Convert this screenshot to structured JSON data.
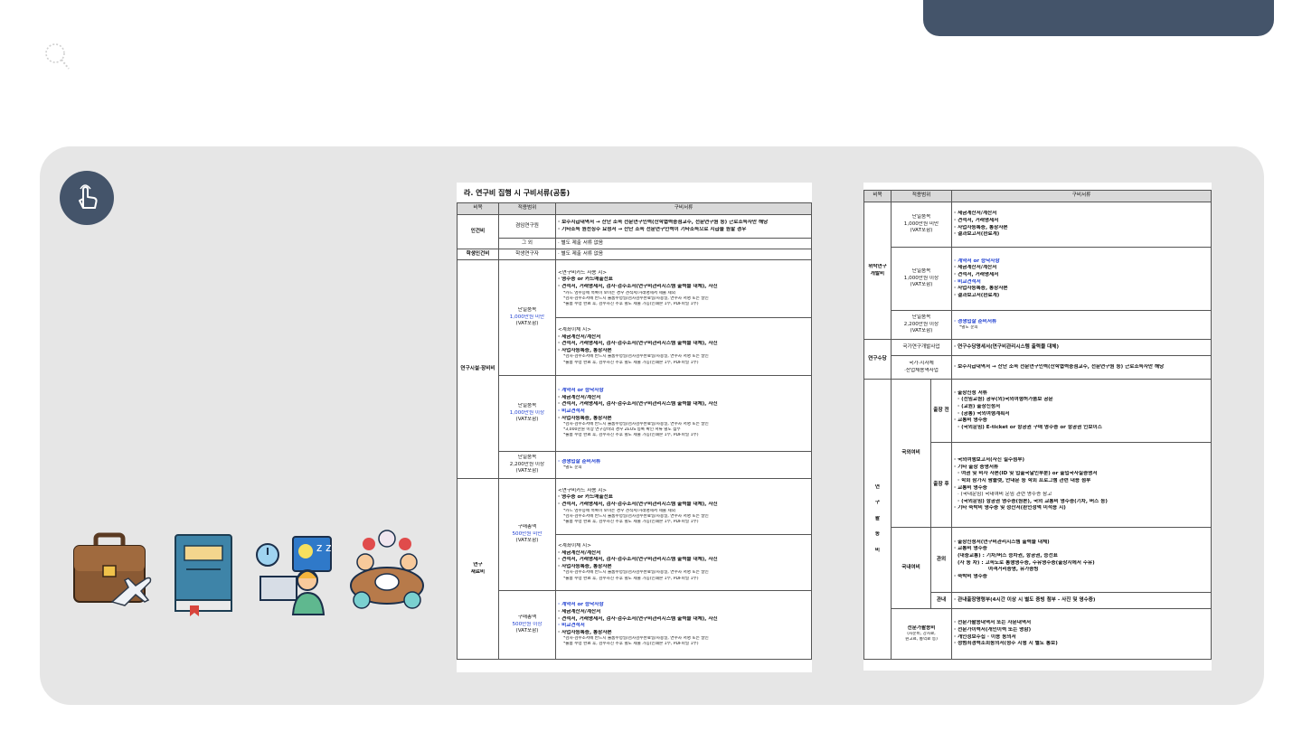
{
  "header": {
    "accent": "#44546a"
  },
  "icons": {
    "touch": "touch-hand-icon",
    "set": [
      "briefcase-travel-icon",
      "book-icon",
      "meeting-work-icon",
      "discussion-group-icon"
    ]
  },
  "left": {
    "title": "라. 연구비 집행 시 구비서류(공통)",
    "h1": "비목",
    "h2": "적용범위",
    "h3": "구비서류",
    "r1": {
      "cat": "인건비",
      "scope": "겸임연구원",
      "d1": "· 보수지급내역서 → 산단 소속 전문연구인력(산학협력중점교수, 전문연구원 등) 근로소득자만 해당",
      "d2": "· 기타소득 원천징수 요청서 → 산단 소속 전문연구인력이 기타소득으로 지급을 원할 경우"
    },
    "r2": {
      "scope": "그 외",
      "d": "· 별도 제출 서류 없음"
    },
    "r3": {
      "cat": "학생인건비",
      "scope": "학생연구자",
      "d": "· 별도 제출 서류 없음"
    },
    "r4": {
      "cat": "연구시설·장비비",
      "s1": {
        "scope1": "단일품목",
        "scope2": "1,000만원 미만",
        "scope3": "(VAT포함)",
        "a0": "<연구비카드 사용 시>",
        "a1": "· 영수증 or 카드매출전표",
        "a2": "· 견적서, 거래명세서, 검사·검수조서(연구비관리시스템 출력물 대체), 사진",
        "a3": "*카드 영수증에 목록이 보이는 경우 견적서/거래명세서 제출 제외",
        "a4": "*검사·검수조서에 반드시 물품수령일/검사검수완료일/사용일, 연수자 서명 또는 날인",
        "a5": "*물품 수령 완료 후, 검수사진 추후 별도 제출 가능(인쇄본 1부, PDF파일 1부)",
        "b0": "<계좌이체 시>",
        "b1": "· 세금계산서/계산서",
        "b2": "· 견적서, 거래명세서, 검사·검수조서(연구비관리시스템 출력물 대체), 사진",
        "b3": "· 사업자등록증, 통장사본",
        "b4": "*검사·검수조서에 반드시 물품수령일/검사검수완료일/사용일, 연수자 서명 또는 날인",
        "b5": "*물품 수령 완료 후, 검수사진 추후 별도 제출 가능(인쇄본 1부, PDF파일 1부)"
      },
      "s2": {
        "scope1": "단일품목",
        "scope2": "1,000만원 이상",
        "scope3": "(VAT포함)",
        "c1": "· 계약서 or 승낙사항",
        "c2": "· 세금계산서/계산서",
        "c3": "· 견적서, 거래명세서, 검사·검수조서(연구비관리시스템 출력물 대체), 사진",
        "c4": "· 비교견적서",
        "c5": "· 사업자등록증, 통장사본",
        "c6": "*검사·검수조서에 반드시 물품수령일/검사검수완료일/사용일, 연수자 서명 또는 날인",
        "c7": "*3,000만원 이상 연구장비의 경우 ZEUS 등록 확인 서류 별도 첨부",
        "c8": "*물품 수령 완료 후, 검수사진 추후 별도 제출 가능(인쇄본 1부, PDF파일 1부)"
      },
      "s3": {
        "scope1": "단일품목",
        "scope2": "2,200만원 이상",
        "scope3": "(VAT포함)",
        "d1": "· 경쟁입찰 준비서류",
        "d2": "*별도 문의"
      }
    },
    "r5": {
      "cat1": "연구",
      "cat2": "재료비",
      "s1": {
        "scope1": "구매총액",
        "scope2": "500만원 미만",
        "scope3": "(VAT포함)",
        "a0": "<연구비카드 사용 시>",
        "a1": "· 영수증 or 카드매출전표",
        "a2": "· 견적서, 거래명세서, 검사·검수조서(연구비관리시스템 출력물 대체), 사진",
        "a3": "*카드 영수증에 목록이 보이는 경우 견적서/거래명세서 제출 제외",
        "a4": "*검사·검수조서에 반드시 물품수령일/검사검수완료일/사용일, 연수자 서명 또는 날인",
        "a5": "*물품 수령 완료 후, 검수사진 추후 별도 제출 가능(인쇄본 1부, PDF파일 1부)",
        "b0": "<계좌이체 시>",
        "b1": "· 세금계산서/계산서",
        "b2": "· 견적서, 거래명세서, 검사·검수조서(연구비관리시스템 출력물 대체), 사진",
        "b3": "· 사업자등록증, 통장사본",
        "b4": "*검사·검수조서에 반드시 물품수령일/검사검수완료일/사용일, 연수자 서명 또는 날인",
        "b5": "*물품 수령 완료 후, 검수사진 추후 별도 제출 가능(인쇄본 1부, PDF파일 1부)"
      },
      "s2": {
        "scope1": "구매총액",
        "scope2": "500만원 이상",
        "scope3": "(VAT포함)",
        "c1": "· 계약서 or 승낙사항",
        "c2": "· 세금계산서/계산서",
        "c3": "· 견적서, 거래명세서, 검사·검수조서(연구비관리시스템 출력물 대체), 사진",
        "c4": "· 비교견적서",
        "c5": "· 사업자등록증, 통장사본",
        "c6": "*검사·검수조서에 반드시 물품수령일/검사검수완료일/사용일, 연수자 서명 또는 날인",
        "c7": "*물품 수령 완료 후, 검수사진 추후 별도 제출 가능(인쇄본 1부, PDF파일 1부)"
      }
    }
  },
  "right": {
    "h1": "비목",
    "h2": "적용범위",
    "h3": "구비서류",
    "w": {
      "cat1": "위탁연구",
      "cat2": "개발비",
      "s1": {
        "scope1": "단일품목",
        "scope2": "1,000만원 미만",
        "scope3": "(VAT포함)",
        "d1": "· 세금계산서/계산서",
        "d2": "· 견적서, 거래명세서",
        "d3": "· 사업자등록증, 통장사본",
        "d4": "· 결과보고서(완료계)"
      },
      "s2": {
        "scope1": "단일품목",
        "scope2": "1,000만원 이상",
        "scope3": "(VAT포함)",
        "d1": "· 계약서 or 승낙사항",
        "d2": "· 세금계산서/계산서",
        "d3": "· 견적서, 거래명세서",
        "d4": "· 비교견적서",
        "d5": "· 사업자등록증, 통장사본",
        "d6": "· 결과보고서(완료계)"
      },
      "s3": {
        "scope1": "단일품목",
        "scope2": "2,200만원 이상",
        "scope3": "(VAT포함)",
        "d1": "· 경쟁입찰 준비서류",
        "d2": "*별도 문의"
      }
    },
    "y": {
      "cat": "연구수당",
      "s1": "국가연구개발사업",
      "d1": "· 연구수당명세서(연구비관리시스템 출력물 대체)",
      "s2a": "국가·지자체",
      "s2b": "·산업체용역사업",
      "d2": "· 보수지급내역서 → 산단 소속 전문연구인력(산학협력중점교수, 전문연구원 등) 근로소득자만 해당"
    },
    "h": {
      "cat": [
        "연",
        "구",
        "활",
        "동",
        "비"
      ],
      "abroad": "국외여비",
      "before": "출장 전",
      "b1": "· 출장신청 서류",
      "b2": "· (전임교원) 공무(외)국외여행허가품보 공문",
      "b3": "· (교원) 출장신청서",
      "b4": "· (공통) 국외여행계획서",
      "b5": "· 교통비 영수증",
      "b6": "· (국외운임) E-ticket or 항공권 구매 영수증 or 항공권 인보이스",
      "after": "출장 후",
      "a1": "· 국외여행보고서(사진 필수첨부)",
      "a2": "· 기타 출장 증명서류",
      "a3": "· 여권 및 비자 사본(ID 및 입출국날인부분) or 출입국사실증명서",
      "a4": "· 학회 참가시 팜플렛, 안내문 등 학회 프로그램 관련 내용 첨부",
      "a5": "· 교통비 영수증",
      "a6": "· (국내운임) 국내여비 운임 관련 영수증 참고",
      "a7": "· (국외운임) 항공권 영수증(원본), 국외 교통비 영수증(기차, 버스 등)",
      "a8": "· 기타 숙박비 영수증 및 정산서(환인정액 미적용 시)",
      "domestic": "국내여비",
      "dist": "관외",
      "d1": "· 출장신청서(연구비관리시스템 출력물 대체)",
      "d2": "· 교통비 영수증",
      "d3": "(대중교통) : 기차/버스 승차권, 항공권, 승선표",
      "d4": "(자 동 차) : 고속도로 통행영수증, 주유영수증(출장지에서 주유)",
      "d5": "여객거리증명, 유가증빙",
      "d6": "· 숙박비 영수증",
      "near": "관내",
      "n1": "· 관내출장명령부(4시간 이상 시 별도 증빙 첨부 - 사진 및 영수증)",
      "exp1": "전문가활용비",
      "exp2": "(자문비, 강사료,",
      "exp3": "원고료, 통역료 등)",
      "e1": "· 전문가활용내역서 또는 자문내역서",
      "e2": "· 전문가이력서(개인이력 또는 명함)",
      "e3": "· 개인정보수집 · 이용 동의서",
      "e4": "· 성범죄경력조회동의서(청주 시행 시 별도 통보)"
    }
  }
}
